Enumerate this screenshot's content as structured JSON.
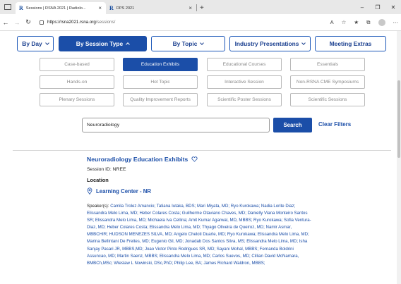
{
  "browser": {
    "tabs": [
      {
        "label": "Sessions | RSNA 2021 | Radiolo...",
        "active": true
      },
      {
        "label": "DPS 2021",
        "active": false
      }
    ],
    "address_host": "https://rsna2021.rsna.org",
    "address_path": "/sessions/"
  },
  "nav": {
    "by_day": "By Day",
    "by_session_type": "By Session Type",
    "by_topic": "By Topic",
    "industry": "Industry Presentations",
    "meeting_extras": "Meeting Extras"
  },
  "session_types": [
    "Case-based",
    "Education Exhibits",
    "Educational Courses",
    "Essentials",
    "Hands-on",
    "Hot Topic",
    "Interactive Session",
    "Non-RSNA CME Symposiums",
    "Plenary Sessions",
    "Quality Improvement Reports",
    "Scientific Poster Sessions",
    "Scientific Sessions"
  ],
  "selected_session_type": "Education Exhibits",
  "search": {
    "value": "Neuroradiology",
    "button": "Search",
    "clear": "Clear Filters"
  },
  "result": {
    "title": "Neuroradiology Education Exhibits",
    "session_id": "Session ID: NREE",
    "location_label": "Location",
    "location": "Learning Center - NR",
    "speakers_label": "Speaker(s):",
    "speakers": "Camila Trolez Amancio; Tatiana Iutaka, BDS; Mari Miyata, MD; Ryo Kurokawa; Nadia Lorite Diaz; Elissandra Melo Lima, MD; Heber Colares Costa; Guilherme Otaviano Chaves, MD; Danielly Viana Monteiro Santos SR; Elissandra Melo Lima, MD; Michaela Iva Cellina; Amit Kumar Agarwal, MD, MBBS; Ryo Kurokawa; Sofia Ventura- Diaz, MD; Heber Colares Costa; Elissandra Melo Lima, MD; Thyago Oliveira de Queiroz, MD; Namir Asmar, MBBCHIR; HUDSON MENEZES SILVA, MD; Angelo Cheloti Duarte, MD; Ryo Kurokawa; Elissandra Melo Lima, MD; Marina Bellintani De Freites, MD; Eugenio Gil, MD; Jonadab Dos Santos Silva, MS; Elissandra Melo Lima, MD; Isha Sanjay Pasari JR, MBBS,MD; Joao Victor Pinto Rodrigues SR, MD; Sayani Mohal, MBBS; Fernanda Boldrini Assuncao, MD; Martin Saenz, MBBS; Elissandra Melo Lima, MD; Carlos Suevos, MD; Cillian David McNamara, BMBCh,MSc; Wieslaw L Nowinski, DSc,PhD; Philip Lee, BA; James Richard Waldron, MBBS;"
  },
  "colors": {
    "brand_blue": "#1b4ea8",
    "chip_border": "#b9b9b9"
  }
}
